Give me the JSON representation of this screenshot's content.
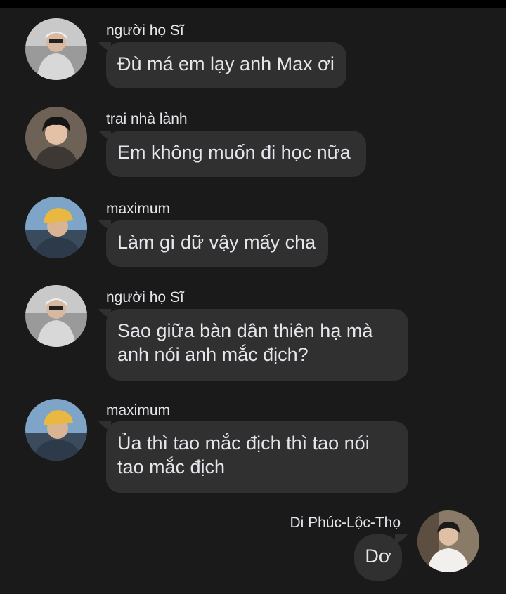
{
  "messages": [
    {
      "sender": "người họ Sĩ",
      "text": "Đù má em lạy anh Max ơi",
      "avatar": "avatar-silver-hair"
    },
    {
      "sender": "trai nhà lành",
      "text": "Em không muốn đi học nữa",
      "avatar": "avatar-dark-hair"
    },
    {
      "sender": "maximum",
      "text": "Làm gì dữ vậy mấy cha",
      "avatar": "avatar-yellow-cap"
    },
    {
      "sender": "người họ Sĩ",
      "text": "Sao giữa bàn dân thiên hạ mà anh nói anh mắc địch?",
      "avatar": "avatar-silver-hair"
    },
    {
      "sender": "maximum",
      "text": "Ủa thì tao mắc địch thì tao nói tao mắc địch",
      "avatar": "avatar-yellow-cap"
    },
    {
      "sender": "Di Phúc-Lộc-Thọ",
      "text": "Dơ",
      "avatar": "avatar-white-shirt"
    }
  ],
  "colors": {
    "background": "#1a1a1a",
    "bubble": "#303030",
    "text": "#e4e6eb"
  }
}
